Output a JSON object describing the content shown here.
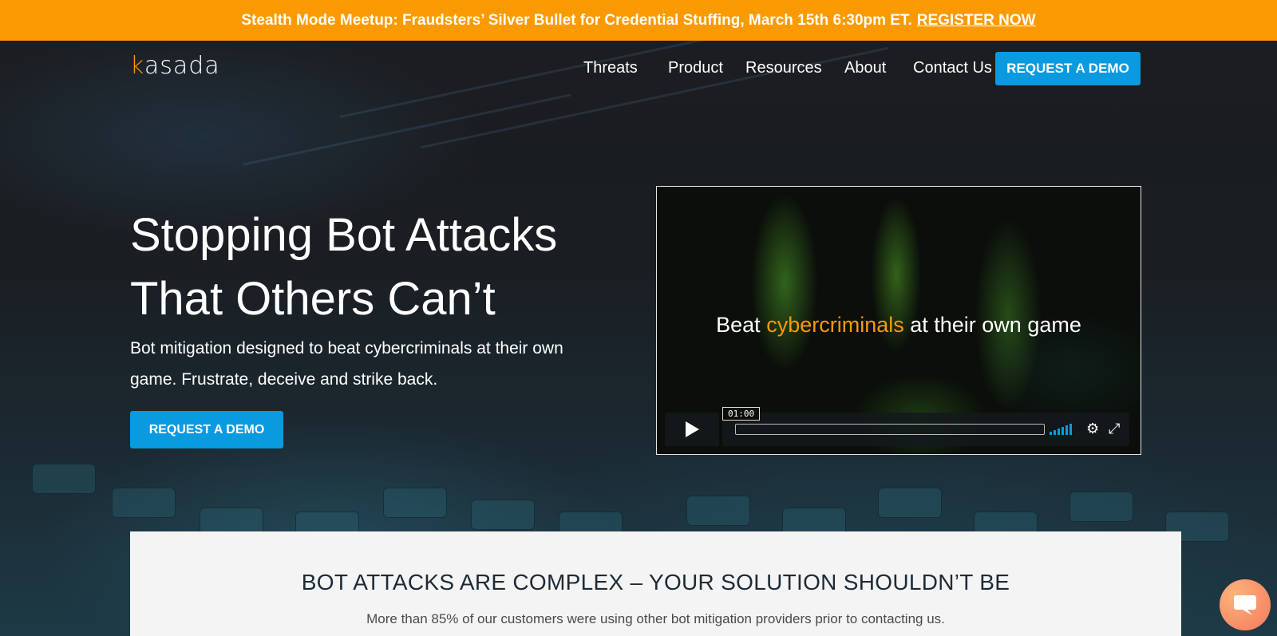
{
  "announcement": {
    "text": "Stealth Mode Meetup: Fraudsters’ Silver Bullet for Credential Stuffing, March 15th 6:30pm ET.",
    "link_label": "REGISTER NOW",
    "color": "#fb9a00"
  },
  "nav": {
    "logo_k": "k",
    "logo_rest": "asada",
    "links": [
      "Threats",
      "Product",
      "Resources",
      "About",
      "Contact Us"
    ],
    "cta_label": "REQUEST A DEMO",
    "cta_color": "#0a9ae0"
  },
  "hero": {
    "headline_line1": "Stopping Bot Attacks",
    "headline_line2": "That Others Can’t",
    "subhead_line1": "Bot mitigation designed to beat cybercriminals at their own",
    "subhead_line2": "game. Frustrate, deceive and strike back.",
    "cta_label": "REQUEST A DEMO"
  },
  "video": {
    "title_prefix": "Beat",
    "title_highlight": "cybercriminals",
    "title_suffix": "at their own game",
    "time": "01:00",
    "icons": [
      "play-icon",
      "volume-icon",
      "settings-gear-icon",
      "fullscreen-icon"
    ]
  },
  "section": {
    "heading": "BOT ATTACKS ARE COMPLEX – YOUR SOLUTION SHOULDN’T BE",
    "body": "More than 85% of our customers were using other bot mitigation providers prior to contacting us."
  },
  "chat": {
    "icon": "chat-bubble-icon"
  }
}
